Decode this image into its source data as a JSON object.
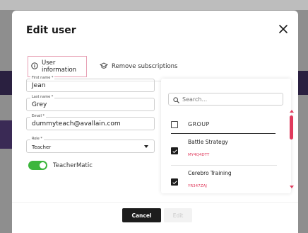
{
  "dialog": {
    "title": "Edit user",
    "close_icon": "close-icon",
    "tabs": [
      {
        "label": "User information",
        "icon": "info-icon",
        "active": true
      },
      {
        "label": "Remove subscriptions",
        "icon": "graduation-cap-icon",
        "active": false
      }
    ]
  },
  "form": {
    "first_name": {
      "label": "First name *",
      "value": "Jean"
    },
    "last_name": {
      "label": "Last name *",
      "value": "Grey"
    },
    "email": {
      "label": "Email *",
      "value": "dummyteach@avallain.com"
    },
    "role": {
      "label": "Role *",
      "value": "Teacher"
    },
    "toggle": {
      "label": "TeacherMatic",
      "on": true
    }
  },
  "groups_panel": {
    "search_placeholder": "Search...",
    "header": "GROUP",
    "rows": [
      {
        "name": "Battle Strategy",
        "code": "MY4Q4DTT",
        "checked": true
      },
      {
        "name": "Cerebro Training",
        "code": "YR347ZAJ",
        "checked": true
      }
    ]
  },
  "footer": {
    "cancel_label": "Cancel",
    "edit_label": "Edit"
  },
  "colors": {
    "accent": "#e03a5c",
    "toggle_on": "#3cb63c",
    "primary_button": "#1d1d1d"
  }
}
